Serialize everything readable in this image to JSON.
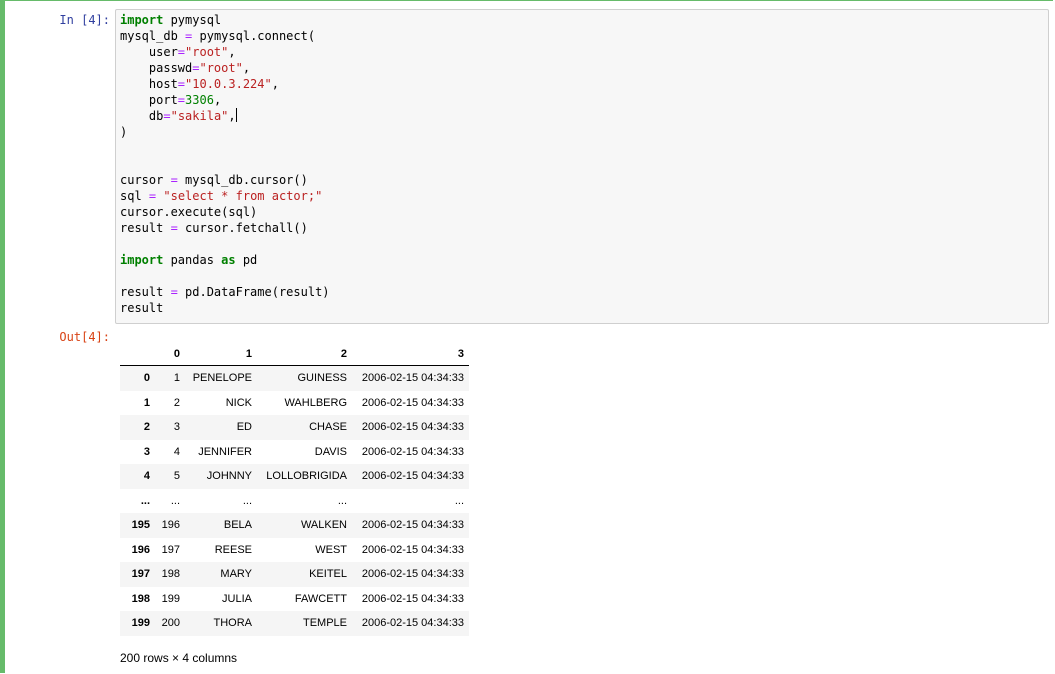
{
  "input_prompt": "In [4]:",
  "output_prompt": "Out[4]:",
  "code_lines": [
    [
      {
        "t": "import",
        "c": "kw"
      },
      {
        "t": " pymysql",
        "c": ""
      }
    ],
    [
      {
        "t": "mysql_db ",
        "c": ""
      },
      {
        "t": "=",
        "c": "op"
      },
      {
        "t": " pymysql.connect(",
        "c": ""
      }
    ],
    [
      {
        "t": "    user",
        "c": ""
      },
      {
        "t": "=",
        "c": "op"
      },
      {
        "t": "\"root\"",
        "c": "str"
      },
      {
        "t": ",",
        "c": ""
      }
    ],
    [
      {
        "t": "    passwd",
        "c": ""
      },
      {
        "t": "=",
        "c": "op"
      },
      {
        "t": "\"root\"",
        "c": "str"
      },
      {
        "t": ",",
        "c": ""
      }
    ],
    [
      {
        "t": "    host",
        "c": ""
      },
      {
        "t": "=",
        "c": "op"
      },
      {
        "t": "\"10.0.3.224\"",
        "c": "str"
      },
      {
        "t": ",",
        "c": ""
      }
    ],
    [
      {
        "t": "    port",
        "c": ""
      },
      {
        "t": "=",
        "c": "op"
      },
      {
        "t": "3306",
        "c": "num"
      },
      {
        "t": ",",
        "c": ""
      }
    ],
    [
      {
        "t": "    db",
        "c": ""
      },
      {
        "t": "=",
        "c": "op"
      },
      {
        "t": "\"sakila\"",
        "c": "str"
      },
      {
        "t": ",",
        "c": ""
      },
      {
        "t": "",
        "c": "cursor"
      }
    ],
    [
      {
        "t": ")",
        "c": ""
      }
    ],
    [],
    [],
    [
      {
        "t": "cursor ",
        "c": ""
      },
      {
        "t": "=",
        "c": "op"
      },
      {
        "t": " mysql_db.cursor()",
        "c": ""
      }
    ],
    [
      {
        "t": "sql ",
        "c": ""
      },
      {
        "t": "=",
        "c": "op"
      },
      {
        "t": " ",
        "c": ""
      },
      {
        "t": "\"select * from actor;\"",
        "c": "str"
      }
    ],
    [
      {
        "t": "cursor.execute(sql)",
        "c": ""
      }
    ],
    [
      {
        "t": "result ",
        "c": ""
      },
      {
        "t": "=",
        "c": "op"
      },
      {
        "t": " cursor.fetchall()",
        "c": ""
      }
    ],
    [],
    [
      {
        "t": "import",
        "c": "kw"
      },
      {
        "t": " pandas ",
        "c": ""
      },
      {
        "t": "as",
        "c": "kw"
      },
      {
        "t": " pd",
        "c": ""
      }
    ],
    [],
    [
      {
        "t": "result ",
        "c": ""
      },
      {
        "t": "=",
        "c": "op"
      },
      {
        "t": " pd.DataFrame(result)",
        "c": ""
      }
    ],
    [
      {
        "t": "result",
        "c": ""
      }
    ]
  ],
  "table": {
    "columns": [
      "",
      "0",
      "1",
      "2",
      "3"
    ],
    "rows": [
      [
        "0",
        "1",
        "PENELOPE",
        "GUINESS",
        "2006-02-15 04:34:33"
      ],
      [
        "1",
        "2",
        "NICK",
        "WAHLBERG",
        "2006-02-15 04:34:33"
      ],
      [
        "2",
        "3",
        "ED",
        "CHASE",
        "2006-02-15 04:34:33"
      ],
      [
        "3",
        "4",
        "JENNIFER",
        "DAVIS",
        "2006-02-15 04:34:33"
      ],
      [
        "4",
        "5",
        "JOHNNY",
        "LOLLOBRIGIDA",
        "2006-02-15 04:34:33"
      ],
      [
        "...",
        "...",
        "...",
        "...",
        "..."
      ],
      [
        "195",
        "196",
        "BELA",
        "WALKEN",
        "2006-02-15 04:34:33"
      ],
      [
        "196",
        "197",
        "REESE",
        "WEST",
        "2006-02-15 04:34:33"
      ],
      [
        "197",
        "198",
        "MARY",
        "KEITEL",
        "2006-02-15 04:34:33"
      ],
      [
        "198",
        "199",
        "JULIA",
        "FAWCETT",
        "2006-02-15 04:34:33"
      ],
      [
        "199",
        "200",
        "THORA",
        "TEMPLE",
        "2006-02-15 04:34:33"
      ]
    ]
  },
  "shape_note": "200 rows × 4 columns",
  "colors": {
    "selected_cell_border": "#66bb6a",
    "input_prompt": "#303f9f",
    "output_prompt": "#d84315",
    "keyword": "#008000",
    "operator": "#aa22ff",
    "string": "#ba2121"
  }
}
